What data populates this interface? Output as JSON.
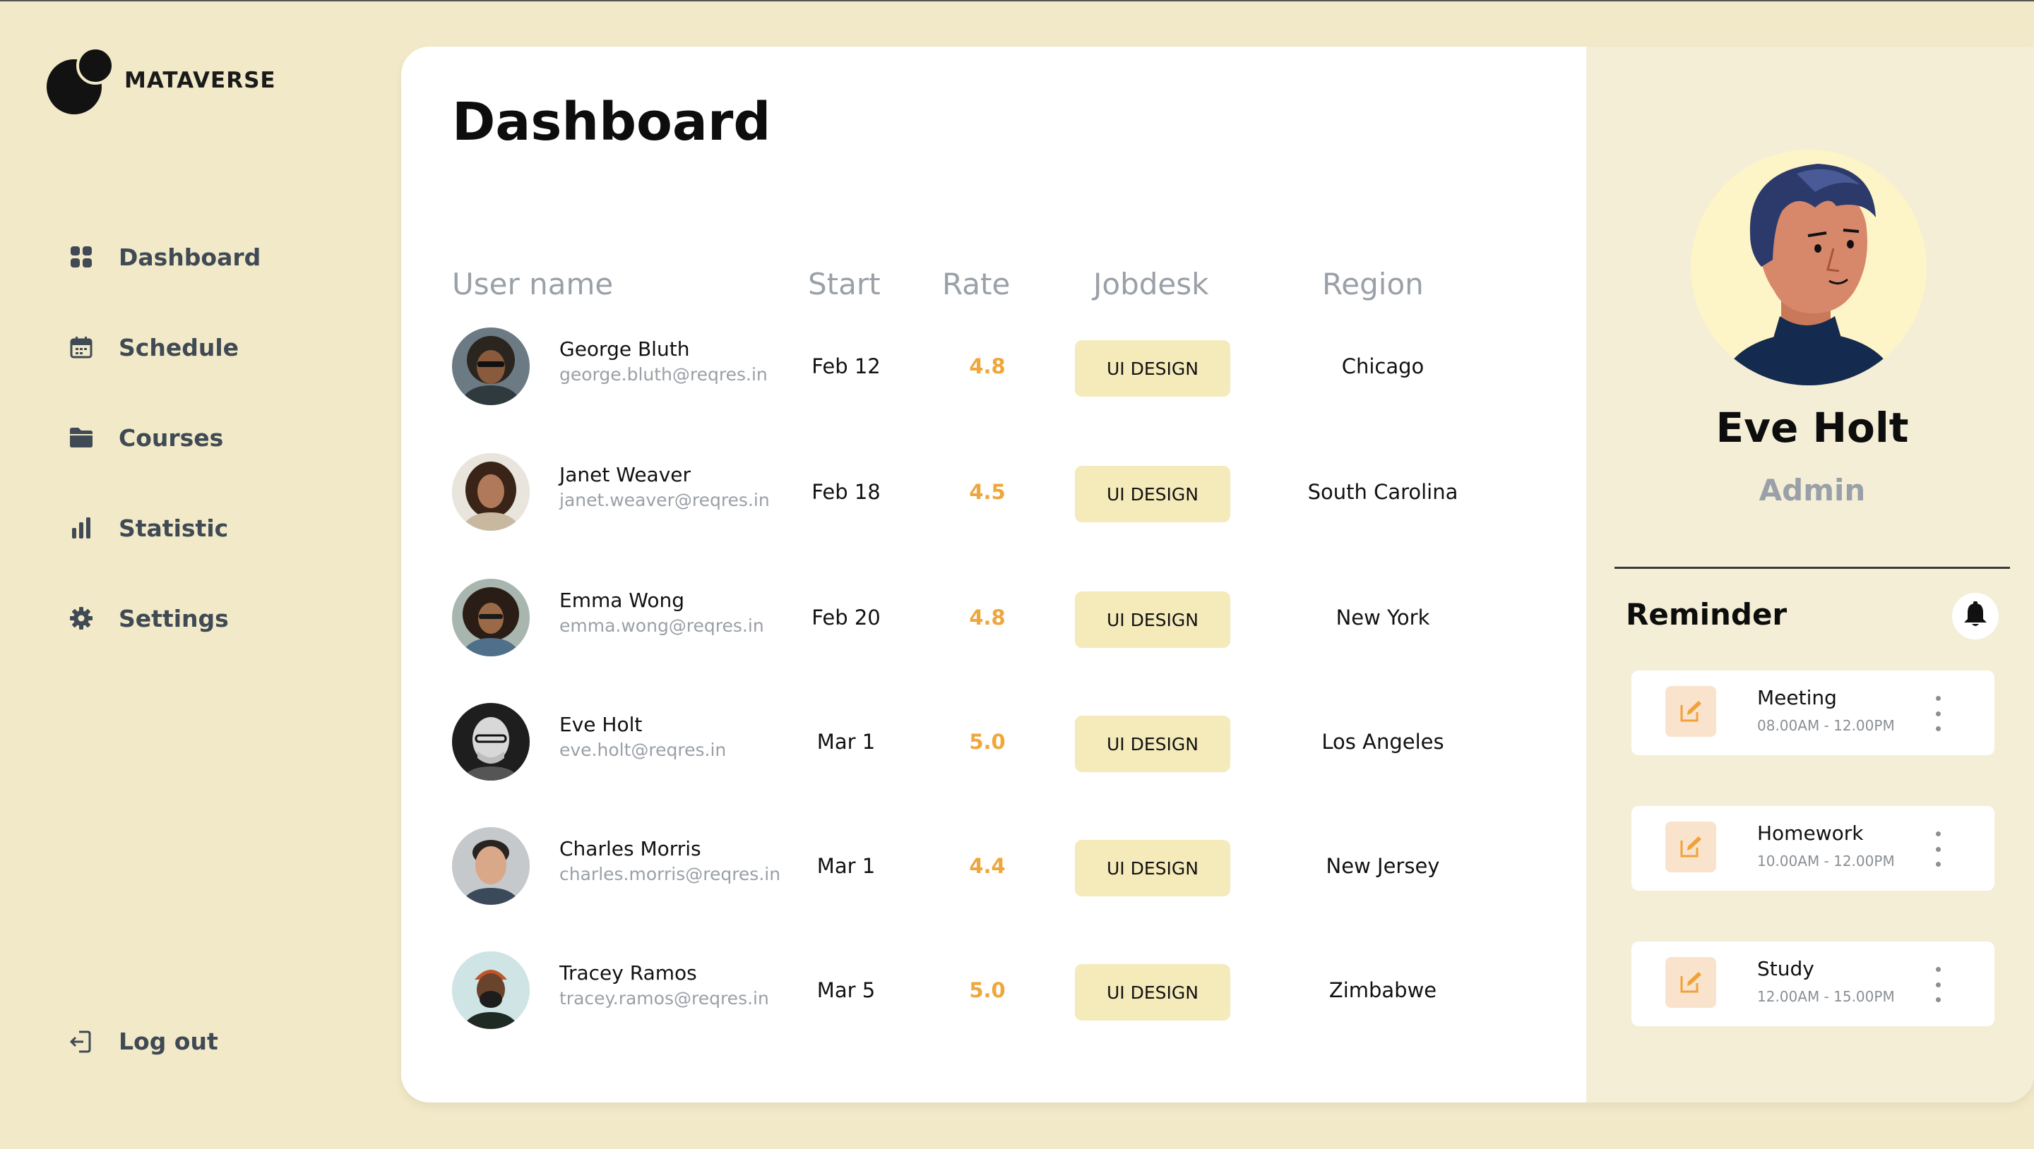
{
  "app": {
    "brand": "MATAVERSE"
  },
  "colors": {
    "background": "#f2e9c8",
    "accent": "#efa63a",
    "chip": "#f4eaba",
    "panel": "#f4eed6"
  },
  "sidebar": {
    "items": [
      {
        "label": "Dashboard",
        "icon": "grid-icon"
      },
      {
        "label": "Schedule",
        "icon": "calendar-icon"
      },
      {
        "label": "Courses",
        "icon": "folder-icon"
      },
      {
        "label": "Statistic",
        "icon": "bar-chart-icon"
      },
      {
        "label": "Settings",
        "icon": "gear-icon"
      }
    ],
    "logout": "Log out"
  },
  "main": {
    "title": "Dashboard",
    "columns": [
      "User name",
      "Start",
      "Rate",
      "Jobdesk",
      "Region"
    ],
    "rows": [
      {
        "name": "George Bluth",
        "email": "george.bluth@reqres.in",
        "start": "Feb 12",
        "rate": "4.8",
        "jobdesk": "UI DESIGN",
        "region": "Chicago"
      },
      {
        "name": "Janet Weaver",
        "email": "janet.weaver@reqres.in",
        "start": "Feb 18",
        "rate": "4.5",
        "jobdesk": "UI DESIGN",
        "region": "South Carolina"
      },
      {
        "name": "Emma Wong",
        "email": "emma.wong@reqres.in",
        "start": "Feb 20",
        "rate": "4.8",
        "jobdesk": "UI DESIGN",
        "region": "New York"
      },
      {
        "name": "Eve Holt",
        "email": "eve.holt@reqres.in",
        "start": "Mar 1",
        "rate": "5.0",
        "jobdesk": "UI DESIGN",
        "region": "Los Angeles"
      },
      {
        "name": "Charles Morris",
        "email": "charles.morris@reqres.in",
        "start": "Mar 1",
        "rate": "4.4",
        "jobdesk": "UI DESIGN",
        "region": "New Jersey"
      },
      {
        "name": "Tracey Ramos",
        "email": "tracey.ramos@reqres.in",
        "start": "Mar 5",
        "rate": "5.0",
        "jobdesk": "UI DESIGN",
        "region": "Zimbabwe"
      }
    ]
  },
  "profile": {
    "name": "Eve Holt",
    "role": "Admin"
  },
  "reminder": {
    "title": "Reminder",
    "items": [
      {
        "title": "Meeting",
        "time": "08.00AM - 12.00PM"
      },
      {
        "title": "Homework",
        "time": "10.00AM - 12.00PM"
      },
      {
        "title": "Study",
        "time": "12.00AM - 15.00PM"
      }
    ]
  }
}
